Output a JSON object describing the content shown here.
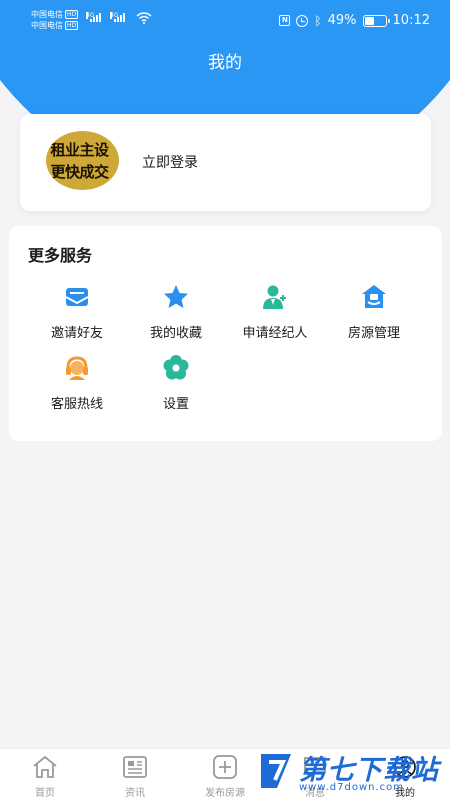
{
  "status_bar": {
    "carrier_1": "中国电信",
    "carrier_2": "中国电信",
    "carrier_1_tag": "HD",
    "carrier_2_tag": "HD",
    "network_1": "4G",
    "network_2": "4G",
    "battery_text": "49%",
    "battery_level": 0.49,
    "time": "10:12",
    "icons": [
      "nfc-icon",
      "alarm-icon",
      "bluetooth-icon",
      "wifi-icon",
      "battery-icon"
    ]
  },
  "header": {
    "title": "我的",
    "color": "#2a97f4"
  },
  "profile": {
    "avatar_line_1": "租业主设",
    "avatar_line_2": "更快成交",
    "login_label": "立即登录"
  },
  "services": {
    "title": "更多服务",
    "items": [
      {
        "label": "邀请好友",
        "icon": "invite-mail-icon",
        "color": "#2a8ff0"
      },
      {
        "label": "我的收藏",
        "icon": "star-icon",
        "color": "#2a8ff0"
      },
      {
        "label": "申请经纪人",
        "icon": "agent-icon",
        "color": "#2bb79a"
      },
      {
        "label": "房源管理",
        "icon": "house-manage-icon",
        "color": "#2a8ff0"
      },
      {
        "label": "客服热线",
        "icon": "headset-icon",
        "color": "#f39a2e"
      },
      {
        "label": "设置",
        "icon": "flower-settings-icon",
        "color": "#2bb79a"
      }
    ]
  },
  "bottom_nav": {
    "items": [
      {
        "label": "首页",
        "icon": "home-icon"
      },
      {
        "label": "资讯",
        "icon": "news-icon"
      },
      {
        "label": "发布房源",
        "icon": "publish-icon"
      },
      {
        "label": "消息",
        "icon": "message-icon"
      },
      {
        "label": "我的",
        "icon": "profile-icon"
      }
    ],
    "active_index": 4
  },
  "watermark": {
    "text": "第七下载站",
    "url": "www.d7down.com"
  }
}
